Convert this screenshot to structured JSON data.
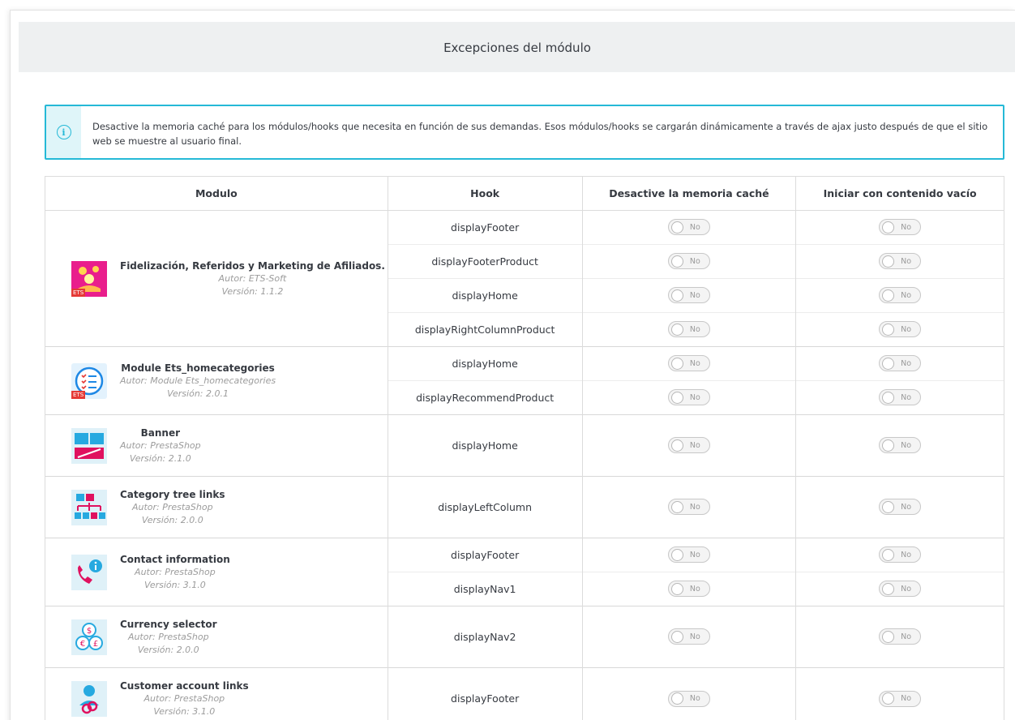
{
  "panel": {
    "title": "Excepciones del módulo"
  },
  "alert": {
    "text": "Desactive la memoria caché para los módulos/hooks que necesita en función de sus demandas. Esos módulos/hooks se cargarán dinámicamente a través de ajax justo después de que el sitio web se muestre al usuario final.",
    "icon": "info-icon",
    "accent_color": "#25b9d7"
  },
  "table": {
    "headers": {
      "module": "Modulo",
      "hook": "Hook",
      "disable_cache": "Desactive la memoria caché",
      "start_empty": "Iniciar con contenido vacío"
    },
    "toggle_label": "No",
    "modules": [
      {
        "name": "Fidelización, Referidos y Marketing de Afiliados.",
        "author": "Autor: ETS-Soft",
        "version": "Versión: 1.1.2",
        "icon": "loyalty-referral-icon",
        "icon_badge": "ETS",
        "hooks": [
          "displayFooter",
          "displayFooterProduct",
          "displayHome",
          "displayRightColumnProduct"
        ]
      },
      {
        "name": "Module Ets_homecategories",
        "author": "Autor: Module Ets_homecategories",
        "version": "Versión: 2.0.1",
        "icon": "checklist-icon",
        "icon_badge": "ETS",
        "hooks": [
          "displayHome",
          "displayRecommendProduct"
        ]
      },
      {
        "name": "Banner",
        "author": "Autor: PrestaShop",
        "version": "Versión: 2.1.0",
        "icon": "banner-icon",
        "hooks": [
          "displayHome"
        ]
      },
      {
        "name": "Category tree links",
        "author": "Autor: PrestaShop",
        "version": "Versión: 2.0.0",
        "icon": "category-tree-icon",
        "hooks": [
          "displayLeftColumn"
        ]
      },
      {
        "name": "Contact information",
        "author": "Autor: PrestaShop",
        "version": "Versión: 3.1.0",
        "icon": "phone-info-icon",
        "hooks": [
          "displayFooter",
          "displayNav1"
        ]
      },
      {
        "name": "Currency selector",
        "author": "Autor: PrestaShop",
        "version": "Versión: 2.0.0",
        "icon": "currency-coins-icon",
        "hooks": [
          "displayNav2"
        ]
      },
      {
        "name": "Customer account links",
        "author": "Autor: PrestaShop",
        "version": "Versión: 3.1.0",
        "icon": "user-link-icon",
        "hooks": [
          "displayFooter"
        ]
      }
    ]
  }
}
